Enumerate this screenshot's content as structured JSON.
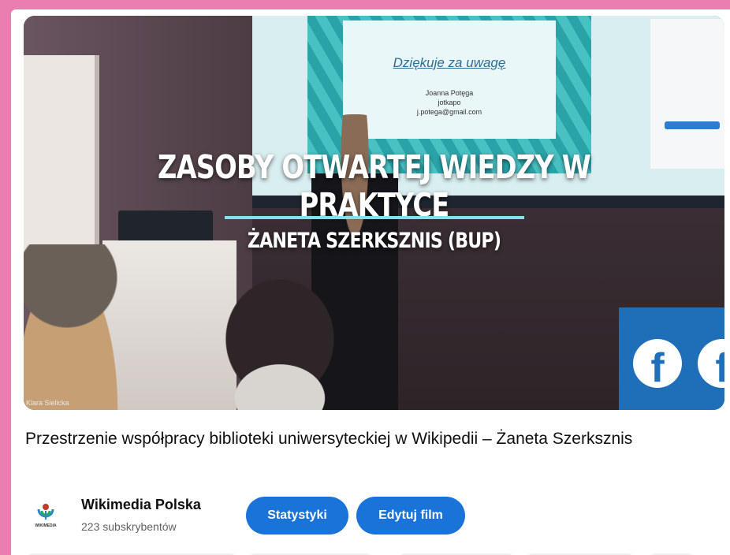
{
  "video": {
    "overlay_title": "ZASOBY OTWARTEJ WIEDZY W PRAKTYCE",
    "overlay_subtitle": "ŻANETA SZERKSZNIS (BUP)",
    "slide_title": "Dziękuje za uwagę",
    "slide_lines": [
      "Joanna Potęga",
      "jotkapo",
      "j.potega@gmail.com"
    ],
    "credit": "Klara Sielicka",
    "accent_color": "#7fe3ee"
  },
  "title": "Przestrzenie współpracy biblioteki uniwersyteckiej w Wikipedii – Żaneta Szerksznis",
  "channel": {
    "name": "Wikimedia Polska",
    "subscribers": "223 subskrybentów",
    "logo_text": "WIKIMEDIA"
  },
  "actions": {
    "stats_label": "Statystyki",
    "edit_label": "Edytuj film",
    "button_color": "#1a73d9"
  },
  "page": {
    "border_color": "#e87fb0"
  }
}
